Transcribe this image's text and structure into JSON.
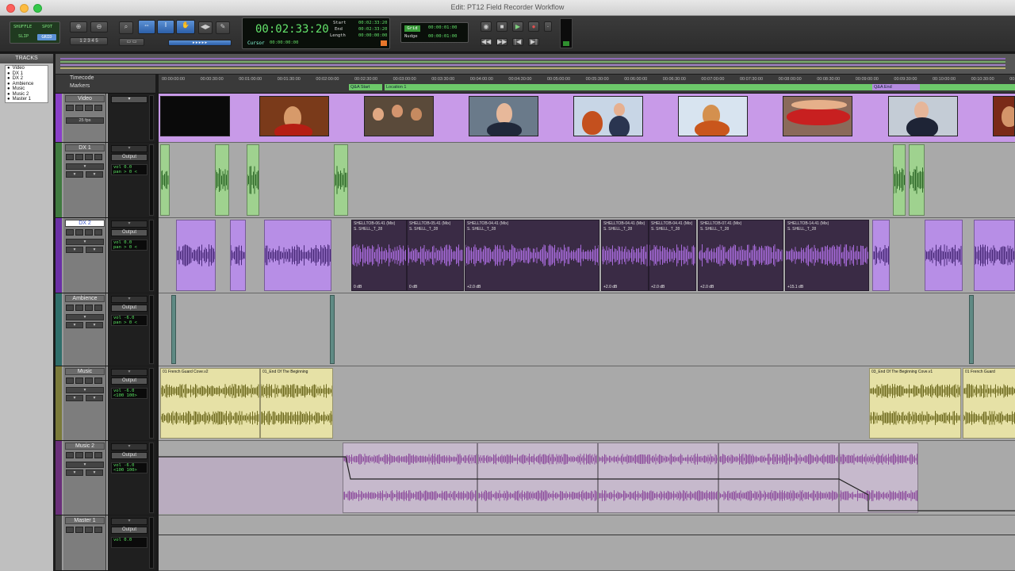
{
  "window": {
    "title": "Edit: PT12 Field Recorder Workflow"
  },
  "colors": {
    "video": "#c89ae8",
    "dialog": "#9fd28f",
    "voice": "#3a2b45",
    "voiceFrame": "#b78ee6",
    "music": "#e6e1a6",
    "musicWave": "#6e6a1f",
    "music2": "#8f4f9e",
    "music2Bg": "#c6b9cc",
    "accent": "#5c92d6"
  },
  "toolbar": {
    "counter_main": "00:02:33:20",
    "counter_sub": "Cursor",
    "counter_cursor": "00:00:00:00",
    "start_label": "Start",
    "end_label": "End",
    "length_label": "Length",
    "start_value": "00:02:33:20",
    "end_value": "00:02:33:20",
    "length_value": "00:00:00:00",
    "grid_label": "Grid",
    "nudge_label": "Nudge",
    "grid_value": "00:00:01:00",
    "nudge_value": "00:00:01:00",
    "mode_left_top": "SHUFFLE",
    "mode_left_mid": "SPOT",
    "mode_left_bot": "SLIP",
    "mode_right_bot": "GRID"
  },
  "tracks_panel": {
    "header": "TRACKS",
    "items": [
      "Video",
      "DX 1",
      "DX 2",
      "Ambience",
      "Music",
      "Music 2",
      "Master 1"
    ]
  },
  "ruler": {
    "label_top": "Timecode",
    "label_bot": "Markers",
    "ticks": [
      "00:00:00:00",
      "00:00:30:00",
      "00:01:00:00",
      "00:01:30:00",
      "00:02:00:00",
      "00:02:30:00",
      "00:03:00:00",
      "00:03:30:00",
      "00:04:00:00",
      "00:04:30:00",
      "00:05:00:00",
      "00:05:30:00",
      "00:06:00:00",
      "00:06:30:00",
      "00:07:00:00",
      "00:07:30:00",
      "00:08:00:00",
      "00:08:30:00",
      "00:09:00:00",
      "00:09:30:00",
      "00:10:00:00",
      "00:10:30:00",
      "00:11:00:00"
    ],
    "markers": [
      "Q&A Start",
      "Location 1",
      "Q&A End"
    ]
  },
  "tracks": [
    {
      "name": "Video",
      "fps": "25 fps"
    },
    {
      "name": "DX 1",
      "io": "Output",
      "vol": "vol 0.0",
      "pan": "pan > 0 <"
    },
    {
      "name": "DX 2",
      "io": "Output",
      "vol": "vol 0.0",
      "pan": "pan > 0 <"
    },
    {
      "name": "Ambience",
      "io": "Output",
      "vol": "vol -6.0",
      "pan": "pan > 0 <"
    },
    {
      "name": "Music",
      "io": "Output",
      "vol": "vol -6.0",
      "pan": "<100 100>"
    },
    {
      "name": "Music 2",
      "io": "Output",
      "vol": "vol -6.0",
      "pan": "<100 100>"
    },
    {
      "name": "Master 1",
      "io": "Output",
      "vol": "vol 0.0"
    }
  ],
  "clips": {
    "voice_names": [
      "SHELLTOB-06.41 (Mix)",
      "SHELLTOB-05.41 (Mix)",
      "SHELLTOB-04.41 (Mix)",
      "SHELLTOB-04.41 (Mix)",
      "SHELLTOB-04.41 (Mix)",
      "SHELLTOB-07.41 (Mix)",
      "SHELLTOB-14.41 (Mix)"
    ],
    "voice_sub": "S. SHELL_T_28",
    "voice_gains": [
      "0 dB",
      "0 dB",
      "+2.0 dB",
      "+2.0 dB",
      "+2.0 dB",
      "+2.0 dB",
      "+15.1 dB"
    ],
    "music_names": [
      "01 French Guard Cove.v2",
      "01_End Of The Beginning",
      "03_End Of The Beginning Cove.v1",
      "01 French Guard"
    ]
  }
}
